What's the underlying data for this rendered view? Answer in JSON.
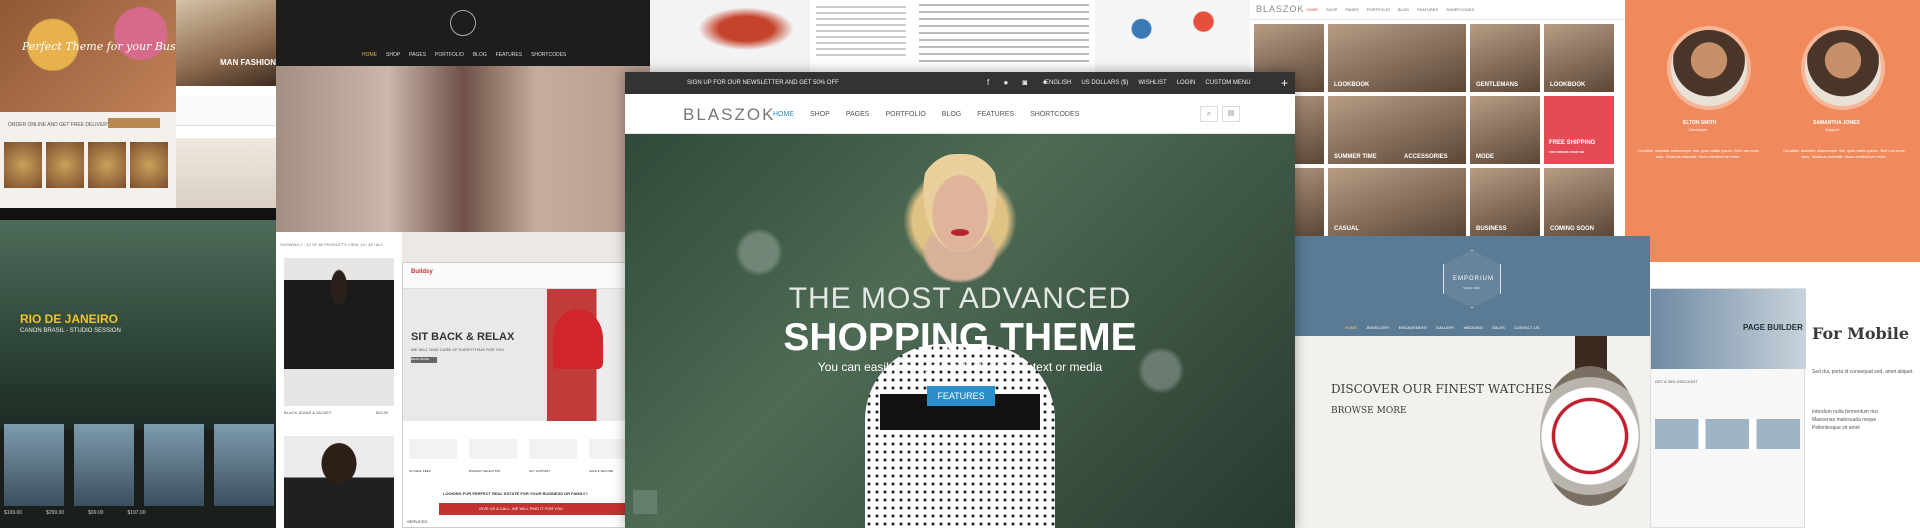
{
  "tiles": {
    "food": {
      "tagline": "Perfect Theme for your Business",
      "info_text": "ORDER ONLINE AND GET FREE DELIVERY"
    },
    "brands": {
      "headline": "MAN FASHION"
    },
    "hipster": {
      "nav": [
        "HOME",
        "SHOP",
        "PAGES",
        "PORTFOLIO",
        "BLOG",
        "FEATURES",
        "SHORTCODES"
      ]
    },
    "rio": {
      "title": "RIO DE JANEIRO",
      "subtitle": "CANON BRASIL - STUDIO SESSION",
      "prices": [
        "$199.00",
        "$299.00",
        "$99.00",
        "$197.00"
      ]
    },
    "products": {
      "toolbar_left": "SHOWING 1 - 12 OF 80 PRODUCTS",
      "toolbar_mid": "VIEW: 24 / 48 / ALL",
      "toolbar_right": "SORT BY NEWNESS",
      "product_name": "BLACK JEANS & JACKET",
      "product_price": "$29.00"
    },
    "realestate": {
      "logo": "Buildsy",
      "hero_title": "SIT BACK & RELAX",
      "hero_sub": "WE WILL TAKE CARE OF EVERYTHING FOR YOU",
      "hero_button": "READ MORE",
      "features": [
        "NO REAL FEES",
        "BIGGEST SELECTION",
        "24/7 SUPPORT",
        "SAFE & SECURE"
      ],
      "cta_title": "LOOKING FOR PERFECT REAL ESTATE FOR YOUR BUSINESS OR FAMILY?",
      "cta_button": "GIVE US A CALL, WE WILL FIND IT FOR YOU",
      "footer_label": "SERVICES"
    },
    "main": {
      "topbar_text": "SIGN UP FOR OUR NEWSLETTER AND GET 50% OFF",
      "topbar_right": [
        "ENGLISH",
        "US DOLLARS ($)",
        "WISHLIST",
        "LOGIN",
        "CUSTOM MENU"
      ],
      "logo": "BLASZOK",
      "nav": [
        "HOME",
        "SHOP",
        "PAGES",
        "PORTFOLIO",
        "BLOG",
        "FEATURES",
        "SHORTCODES"
      ],
      "hero_line1": "THE MOST ADVANCED",
      "hero_line2": "SHOPPING THEME",
      "hero_sub": "You can easily change this text with any text or media",
      "hero_button": "FEATURES"
    },
    "category": {
      "logo": "BLASZOK",
      "nav": [
        "HOME",
        "SHOP",
        "PAGES",
        "PORTFOLIO",
        "BLOG",
        "FEATURES",
        "SHORTCODES"
      ],
      "labels": [
        "LOOKBOOK",
        "GENTLEMANS",
        "LOOKBOOK",
        "SUMMER TIME",
        "ACCESSORIES",
        "MODE",
        "FREE SHIPPING",
        "CASUAL",
        "BUSINESS",
        "COMING SOON"
      ],
      "shipping_sub": "FOR ORDERS OVER $99"
    },
    "team": {
      "members": [
        {
          "name": "ELTON SMITH",
          "role": "Developer"
        },
        {
          "name": "SAMANTHA JONES",
          "role": "Support"
        }
      ],
      "bio": "Curabitur molestie ullamcorper nisi, quis mattis ipsum. Sed non nunc arcu. Vivamus molestie. Nunc eleifend vel enim."
    },
    "emporium": {
      "logo": "EMPORIUM",
      "logo_sub": "SINCE 1980",
      "nav": [
        "HOME",
        "JEWELLERY",
        "ENGAGEMENT",
        "GALLERY",
        "WEDDING",
        "SALES",
        "CONTACT US"
      ],
      "headline": "DISCOVER OUR FINEST WATCHES",
      "link": "BROWSE MORE"
    },
    "mobile": {
      "banner_label": "PAGE BUILDER",
      "title": "For Mobile",
      "body": "Sed dui, porta id consequat sed, amet aliquet.",
      "list": [
        "Interdum nulla fermentum nisi",
        "Maecenas malesuada neque",
        "Pellentesque sit amet"
      ],
      "discount": "GET A 30% DISCOUNT"
    }
  },
  "colors": {
    "accent_blue": "#2a8ec9",
    "coral": "#f08a5d",
    "red": "#c43131",
    "slate": "#5b7a94"
  }
}
